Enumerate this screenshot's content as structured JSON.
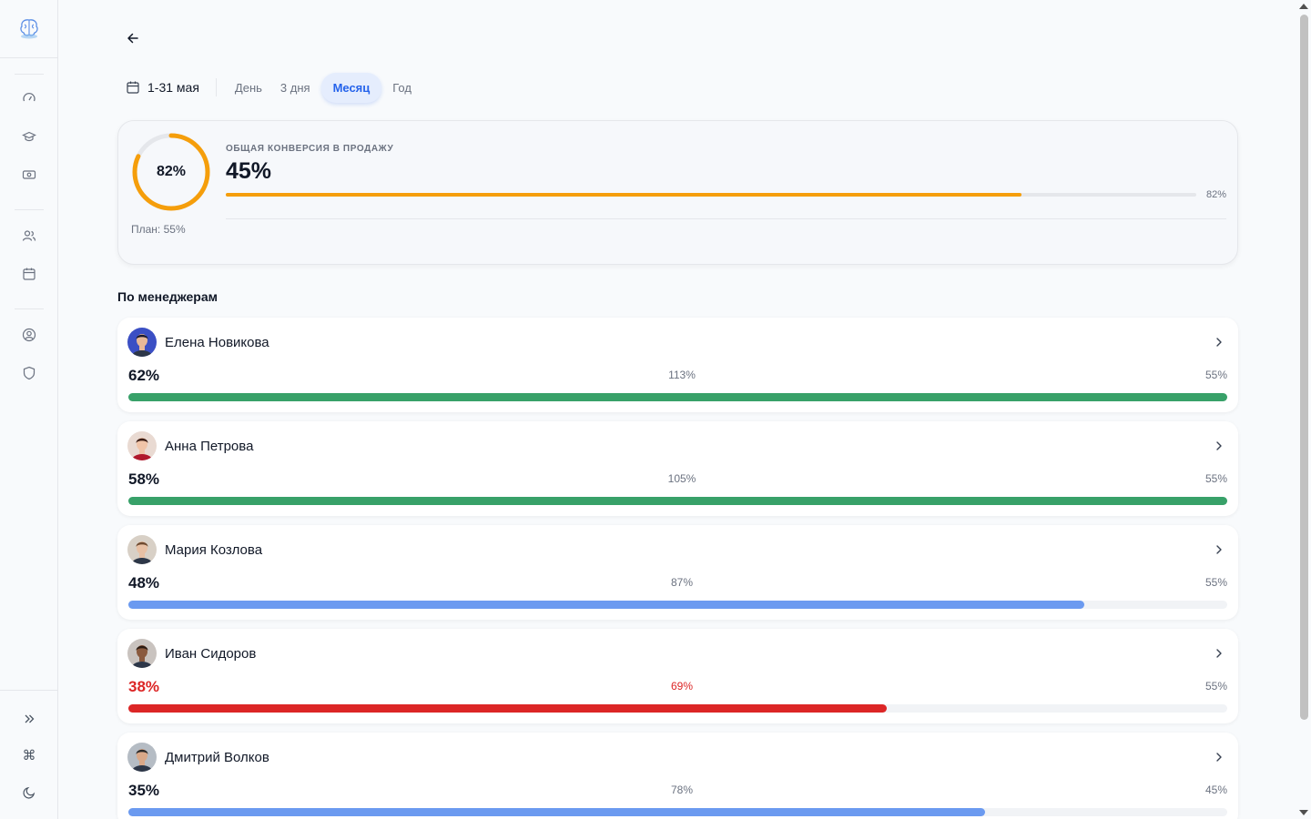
{
  "sidebar": {
    "logo": "brain-logo-icon",
    "items": [
      {
        "icon": "speedometer-icon"
      },
      {
        "icon": "graduation-cap-icon"
      },
      {
        "icon": "money-icon"
      },
      {
        "icon": "users-icon"
      },
      {
        "icon": "calendar-icon"
      },
      {
        "icon": "user-circle-icon"
      },
      {
        "icon": "shield-icon"
      }
    ],
    "bottom": [
      {
        "icon": "chevrons-right-icon"
      },
      {
        "icon": "command-icon"
      },
      {
        "icon": "moon-icon"
      }
    ]
  },
  "period": {
    "date_range": "1-31 мая",
    "tabs": [
      "День",
      "3 дня",
      "Месяц",
      "Год"
    ],
    "active_tab": "Месяц"
  },
  "summary": {
    "ring_label": "82%",
    "ring_value": 0.82,
    "caption": "ОБЩАЯ КОНВЕРСИЯ В ПРОДАЖУ",
    "value": "45%",
    "progress": 0.82,
    "progress_label": "82%",
    "plan": "План: 55%",
    "accent": "#f59e0b"
  },
  "managers_title": "По менеджерам",
  "managers": [
    {
      "name": "Елена Новикова",
      "pct": "62%",
      "mid": "113%",
      "plan": "55%",
      "fill": 1.0,
      "color": "#38a169",
      "alert": false,
      "avatar": {
        "bg": "#3b4fc4",
        "skin": "#e8b898",
        "hair": "#1a1a2e"
      }
    },
    {
      "name": "Анна Петрова",
      "pct": "58%",
      "mid": "105%",
      "plan": "55%",
      "fill": 1.0,
      "color": "#38a169",
      "alert": false,
      "avatar": {
        "bg": "#e9dad2",
        "skin": "#f0c4a8",
        "hair": "#3a1c14",
        "shirt": "#b0182c"
      }
    },
    {
      "name": "Мария Козлова",
      "pct": "48%",
      "mid": "87%",
      "plan": "55%",
      "fill": 0.87,
      "color": "#6b9af0",
      "alert": false,
      "avatar": {
        "bg": "#d8d0c6",
        "skin": "#e8c0a4",
        "hair": "#6e4a30"
      }
    },
    {
      "name": "Иван Сидоров",
      "pct": "38%",
      "mid": "69%",
      "plan": "55%",
      "fill": 0.69,
      "color": "#dc2626",
      "alert": true,
      "avatar": {
        "bg": "#c9c3bf",
        "skin": "#8a5a3e",
        "hair": "#2a1a12"
      }
    },
    {
      "name": "Дмитрий Волков",
      "pct": "35%",
      "mid": "78%",
      "plan": "45%",
      "fill": 0.78,
      "color": "#6b9af0",
      "alert": false,
      "avatar": {
        "bg": "#b5bcc4",
        "skin": "#d9a888",
        "hair": "#2a2a2a"
      }
    }
  ]
}
